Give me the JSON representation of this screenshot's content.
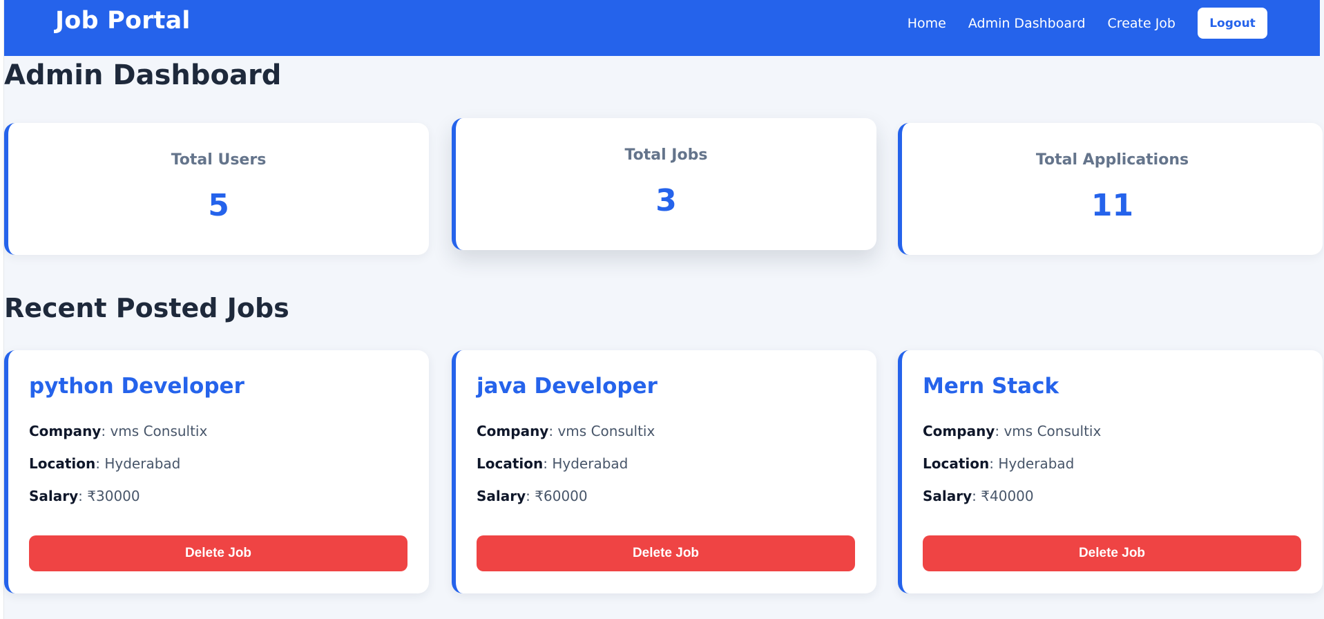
{
  "navbar": {
    "brand": "Job Portal",
    "links": [
      "Home",
      "Admin Dashboard",
      "Create Job"
    ],
    "logout_label": "Logout",
    "color": "#2563eb"
  },
  "page_title": "Admin Dashboard",
  "stats": [
    {
      "label": "Total Users",
      "value": "5"
    },
    {
      "label": "Total Jobs",
      "value": "3"
    },
    {
      "label": "Total Applications",
      "value": "11"
    }
  ],
  "recent_section_title": "Recent Posted Jobs",
  "field_labels": {
    "company": "Company",
    "location": "Location",
    "salary": "Salary"
  },
  "jobs": [
    {
      "title": "python Developer",
      "company": "vms Consultix",
      "location": "Hyderabad",
      "salary": "₹30000",
      "delete_label": "Delete Job"
    },
    {
      "title": "java Developer",
      "company": "vms Consultix",
      "location": "Hyderabad",
      "salary": "₹60000",
      "delete_label": "Delete Job"
    },
    {
      "title": "Mern Stack",
      "company": "vms Consultix",
      "location": "Hyderabad",
      "salary": "₹40000",
      "delete_label": "Delete Job"
    }
  ],
  "colors": {
    "accent": "#2563eb",
    "danger": "#ef4444",
    "background": "#f3f6fb"
  }
}
